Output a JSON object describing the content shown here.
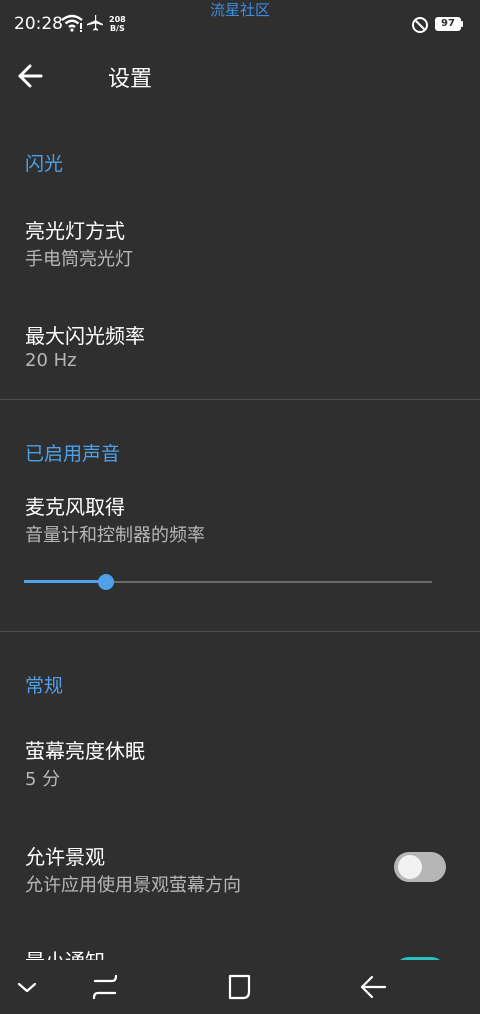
{
  "status_bar": {
    "time": "20:28",
    "net_speed_value": "208",
    "net_speed_unit": "B/S",
    "watermark": "流星社区",
    "battery": "97",
    "icons": [
      "wifi-icon",
      "airplane-icon",
      "do-not-disturb-icon",
      "battery-icon"
    ]
  },
  "toolbar": {
    "title": "设置",
    "back_icon": "arrow-left-icon"
  },
  "sections": {
    "flash": {
      "header": "闪光",
      "light_mode": {
        "title": "亮光灯方式",
        "summary": "手电筒亮光灯"
      },
      "max_flash_rate": {
        "title": "最大闪光频率",
        "summary": "20 Hz"
      }
    },
    "sound": {
      "header": "已启用声音",
      "mic_gain": {
        "title": "麦克风取得",
        "summary": "音量计和控制器的频率",
        "slider_value": 0.2
      }
    },
    "general": {
      "header": "常规",
      "screen_sleep": {
        "title": "萤幕亮度休眠",
        "summary": "5 分"
      },
      "allow_landscape": {
        "title": "允许景观",
        "summary": "允许应用使用景观萤幕方向",
        "enabled": false
      },
      "min_notification": {
        "title": "最小通知",
        "enabled": true
      }
    }
  },
  "colors": {
    "background": "#2f2f2f",
    "accent": "#4ea0e8",
    "toggle_on": "#2cc1c1",
    "summary_text": "#b7b7b7"
  },
  "nav_bar": {
    "icons": [
      "chevron-down-icon",
      "recents-icon",
      "home-icon",
      "back-icon"
    ]
  }
}
